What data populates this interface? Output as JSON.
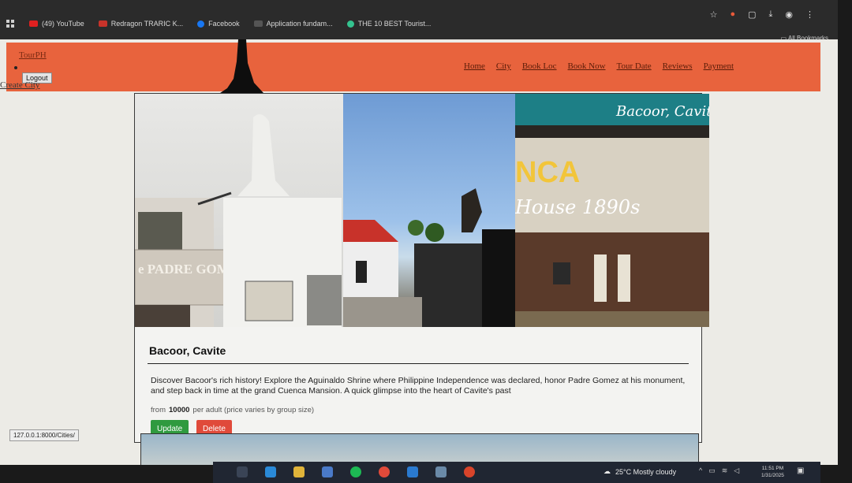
{
  "bookmarks": [
    {
      "label": "(49) YouTube",
      "color": "#e02020"
    },
    {
      "label": "Redragon TRARIC K...",
      "color": "#c8332a"
    },
    {
      "label": "Facebook",
      "color": "#1877f2"
    },
    {
      "label": "Application fundam...",
      "color": "#555555"
    },
    {
      "label": "THE 10 BEST Tourist...",
      "color": "#34c38f"
    }
  ],
  "all_bookmarks": "All Bookmarks",
  "nav": {
    "brand": "TourPH",
    "links": [
      "Home",
      "City",
      "Book Loc",
      "Book Now",
      "Tour Date",
      "Reviews",
      "Payment"
    ],
    "logout": "Logout",
    "create_city": "Create City"
  },
  "city": {
    "image_caption": "Bacoor, Cavite",
    "image_text_1": "NCA",
    "image_text_2": "House 1890s",
    "monument_text": "e PADRE GOMES",
    "title": "Bacoor, Cavite",
    "description": "Discover Bacoor's rich history! Explore the Aguinaldo Shrine where Philippine Independence was declared, honor Padre Gomez at his monument, and step back in time at the grand Cuenca Mansion. A quick glimpse into the heart of Cavite's past",
    "price_prefix": "from",
    "price": "10000",
    "price_suffix": "per adult (price varies by group size)",
    "update": "Update",
    "delete": "Delete"
  },
  "status_url": "127.0.0.1:8000/Cities/",
  "taskbar": {
    "weather": "25°C  Mostly cloudy",
    "time": "11:51 PM",
    "date": "1/31/2025"
  }
}
